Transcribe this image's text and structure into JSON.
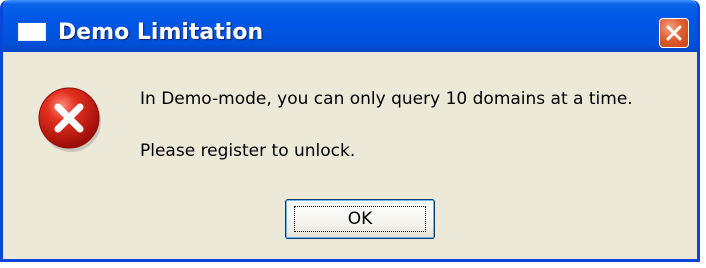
{
  "window": {
    "title": "Demo Limitation",
    "app_icon": "window-icon",
    "close_icon": "close-icon"
  },
  "dialog": {
    "icon": "error-icon",
    "message_line1": "In Demo-mode, you can only query 10 domains at a time.",
    "message_line2": "Please register to unlock.",
    "ok_label": "OK"
  },
  "colors": {
    "title_bar": "#0055e0",
    "frame": "#0a46d8",
    "dialog_bg": "#ece9d8",
    "close_button": "#e0602f",
    "error_icon": "#d8201c"
  }
}
